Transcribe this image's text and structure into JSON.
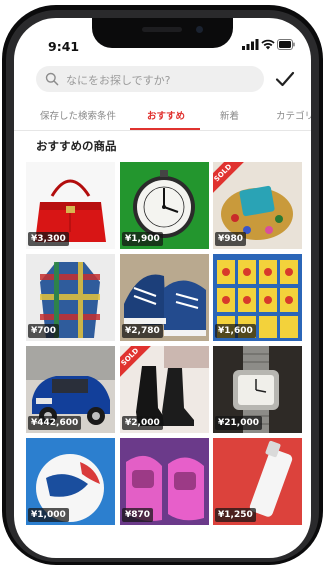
{
  "status": {
    "time": "9:41"
  },
  "search": {
    "placeholder": "なにをお探しですか?"
  },
  "tabs": [
    {
      "label": "保存した検索条件",
      "active": false
    },
    {
      "label": "おすすめ",
      "active": true
    },
    {
      "label": "新着",
      "active": false
    },
    {
      "label": "カテゴリ",
      "active": false
    }
  ],
  "section": {
    "title": "おすすめの商品"
  },
  "items": [
    {
      "name": "red-handbag",
      "price": "¥3,300",
      "sold": false
    },
    {
      "name": "pocket-watch",
      "price": "¥1,900",
      "sold": false
    },
    {
      "name": "gem-ring",
      "price": "¥980",
      "sold": true,
      "sold_label": "SOLD"
    },
    {
      "name": "plaid-coat",
      "price": "¥700",
      "sold": false
    },
    {
      "name": "blue-sneakers",
      "price": "¥2,780",
      "sold": false
    },
    {
      "name": "book-collection",
      "price": "¥1,600",
      "sold": false
    },
    {
      "name": "blue-mini-car",
      "price": "¥442,600",
      "sold": false
    },
    {
      "name": "black-boots",
      "price": "¥2,000",
      "sold": true,
      "sold_label": "SOLD"
    },
    {
      "name": "wristwatch",
      "price": "¥21,000",
      "sold": false
    },
    {
      "name": "soccer-ball",
      "price": "¥1,000",
      "sold": false
    },
    {
      "name": "pink-shoes",
      "price": "¥870",
      "sold": false
    },
    {
      "name": "cosmetic-bottle",
      "price": "¥1,250",
      "sold": false
    }
  ],
  "colors": {
    "accent": "#e0322f",
    "background": "#ffffff",
    "frame": "#0b0b0c"
  }
}
